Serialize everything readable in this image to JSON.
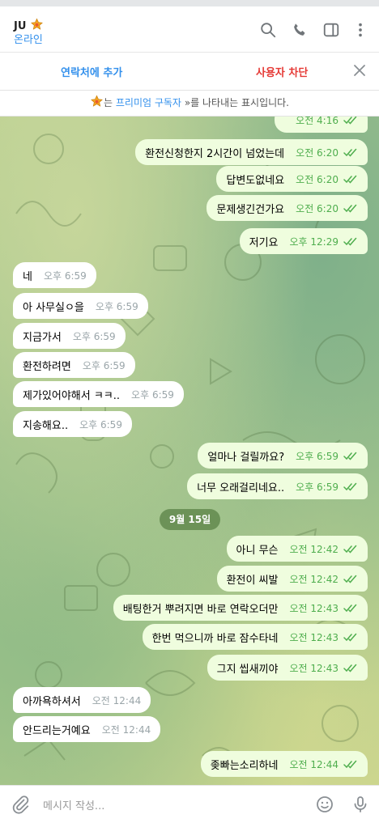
{
  "header": {
    "name": "JU",
    "status": "온라인"
  },
  "action_bar": {
    "add_contact": "연락처에 추가",
    "block_user": "사용자 차단"
  },
  "notice": {
    "part1": "는",
    "link": "프리미엄 구독자",
    "part2": "»를 나타내는 표시입니다."
  },
  "messages": [
    {
      "dir": "out",
      "text": "",
      "time": "오전 4:16"
    },
    {
      "dir": "out",
      "text": "환전신청한지 2시간이 넘었는데",
      "time": "오전 6:20"
    },
    {
      "dir": "out",
      "text": "답변도없네요",
      "time": "오전 6:20"
    },
    {
      "dir": "out",
      "text": "문제생긴건가요",
      "time": "오전 6:20"
    },
    {
      "dir": "out",
      "text": "저기요",
      "time": "오후 12:29"
    },
    {
      "dir": "in",
      "text": "네",
      "time": "오후 6:59"
    },
    {
      "dir": "in",
      "text": "아 사무실ㅇ을",
      "time": "오후 6:59"
    },
    {
      "dir": "in",
      "text": "지금가서",
      "time": "오후 6:59"
    },
    {
      "dir": "in",
      "text": "환전하려면",
      "time": "오후 6:59"
    },
    {
      "dir": "in",
      "text": "제가있어야해서 ㅋㅋ..",
      "time": "오후 6:59"
    },
    {
      "dir": "in",
      "text": "지송해요..",
      "time": "오후 6:59"
    },
    {
      "dir": "out",
      "text": "얼마나 걸릴까요?",
      "time": "오후 6:59"
    },
    {
      "dir": "out",
      "text": "너무 오래걸리네요..",
      "time": "오후 6:59"
    },
    {
      "dir": "out",
      "text": "아니 무슨",
      "time": "오전 12:42"
    },
    {
      "dir": "out",
      "text": "환전이 씨발",
      "time": "오전 12:42"
    },
    {
      "dir": "out",
      "text": "배팅한거 뿌려지면 바로 연락오더만",
      "time": "오전 12:43"
    },
    {
      "dir": "out",
      "text": "한번 먹으니까 바로 잠수타네",
      "time": "오전 12:43"
    },
    {
      "dir": "out",
      "text": "그지 씹새끼야",
      "time": "오전 12:43"
    },
    {
      "dir": "in",
      "text": "아까욕하셔서",
      "time": "오전 12:44"
    },
    {
      "dir": "in",
      "text": "안드리는거예요",
      "time": "오전 12:44"
    },
    {
      "dir": "out",
      "text": "좆빠는소리하네",
      "time": "오전 12:44"
    }
  ],
  "date_separator": "9월 15일",
  "composer": {
    "placeholder": "메시지 작성..."
  },
  "icons": {
    "header": [
      "search-icon",
      "phone-icon",
      "sidebar-toggle-icon",
      "more-vertical-icon"
    ],
    "composer": [
      "attach-icon",
      "emoji-icon",
      "microphone-icon"
    ],
    "read_receipt": "double-check-icon",
    "premium_badge": "star-icon"
  },
  "colors": {
    "accent": "#3390ec",
    "danger": "#e53935",
    "outgoing_bubble": "#effdde",
    "outgoing_time": "#4fae4e",
    "incoming_bubble": "#ffffff"
  }
}
